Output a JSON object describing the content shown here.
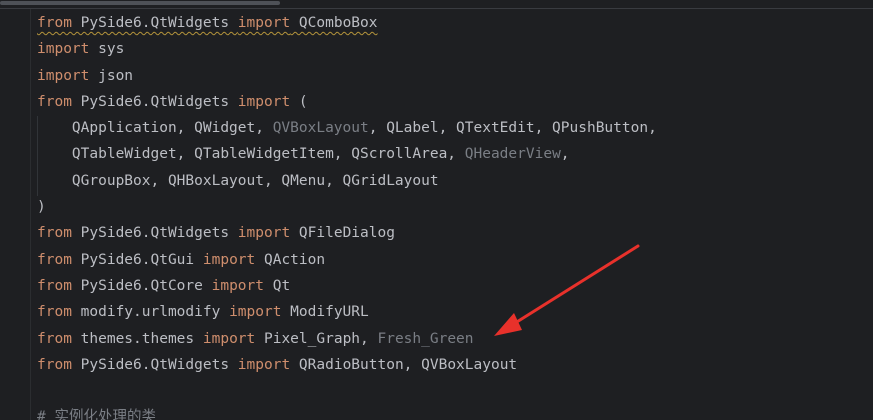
{
  "editor": {
    "lines": [
      [
        {
          "t": "from",
          "c": "kw"
        },
        {
          "t": " PySide6.QtWidgets ",
          "c": "plain"
        },
        {
          "t": "import",
          "c": "kw"
        },
        {
          "t": " QComboBox",
          "c": "plain"
        }
      ],
      [
        {
          "t": "import",
          "c": "kw"
        },
        {
          "t": " sys",
          "c": "plain"
        }
      ],
      [
        {
          "t": "import",
          "c": "kw"
        },
        {
          "t": " json",
          "c": "plain"
        }
      ],
      [
        {
          "t": "from",
          "c": "kw"
        },
        {
          "t": " PySide6.QtWidgets ",
          "c": "plain"
        },
        {
          "t": "import",
          "c": "kw"
        },
        {
          "t": " (",
          "c": "plain"
        }
      ],
      [
        {
          "t": "    QApplication, QWidget, ",
          "c": "plain"
        },
        {
          "t": "QVBoxLayout",
          "c": "dim"
        },
        {
          "t": ", QLabel, QTextEdit, QPushButton,",
          "c": "plain"
        }
      ],
      [
        {
          "t": "    QTableWidget, QTableWidgetItem, QScrollArea, ",
          "c": "plain"
        },
        {
          "t": "QHeaderView",
          "c": "dim"
        },
        {
          "t": ",",
          "c": "plain"
        }
      ],
      [
        {
          "t": "    QGroupBox, QHBoxLayout, QMenu, QGridLayout",
          "c": "plain"
        }
      ],
      [
        {
          "t": ")",
          "c": "plain"
        }
      ],
      [
        {
          "t": "from",
          "c": "kw"
        },
        {
          "t": " PySide6.QtWidgets ",
          "c": "plain"
        },
        {
          "t": "import",
          "c": "kw"
        },
        {
          "t": " QFileDialog",
          "c": "plain"
        }
      ],
      [
        {
          "t": "from",
          "c": "kw"
        },
        {
          "t": " PySide6.QtGui ",
          "c": "plain"
        },
        {
          "t": "import",
          "c": "kw"
        },
        {
          "t": " QAction",
          "c": "plain"
        }
      ],
      [
        {
          "t": "from",
          "c": "kw"
        },
        {
          "t": " PySide6.QtCore ",
          "c": "plain"
        },
        {
          "t": "import",
          "c": "kw"
        },
        {
          "t": " Qt",
          "c": "plain"
        }
      ],
      [
        {
          "t": "from",
          "c": "kw"
        },
        {
          "t": " modify.urlmodify ",
          "c": "plain"
        },
        {
          "t": "import",
          "c": "kw"
        },
        {
          "t": " ModifyURL",
          "c": "plain"
        }
      ],
      [
        {
          "t": "from",
          "c": "kw"
        },
        {
          "t": " themes.themes ",
          "c": "plain"
        },
        {
          "t": "import",
          "c": "kw"
        },
        {
          "t": " Pixel_Graph, ",
          "c": "plain"
        },
        {
          "t": "Fresh_Green",
          "c": "dim"
        }
      ],
      [
        {
          "t": "from",
          "c": "kw"
        },
        {
          "t": " PySide6.QtWidgets ",
          "c": "plain"
        },
        {
          "t": "import",
          "c": "kw"
        },
        {
          "t": " QRadioButton, QVBoxLayout",
          "c": "plain"
        }
      ],
      [],
      [
        {
          "t": "# 实例化处理的类",
          "c": "comment"
        }
      ]
    ]
  },
  "colors": {
    "background": "#1e1f22",
    "keyword": "#cf8e6d",
    "identifier": "#bcbec4",
    "unused_import": "#7a7e85",
    "annotation_arrow": "#e8312b"
  },
  "annotation": {
    "icon": "red-arrow-icon"
  }
}
